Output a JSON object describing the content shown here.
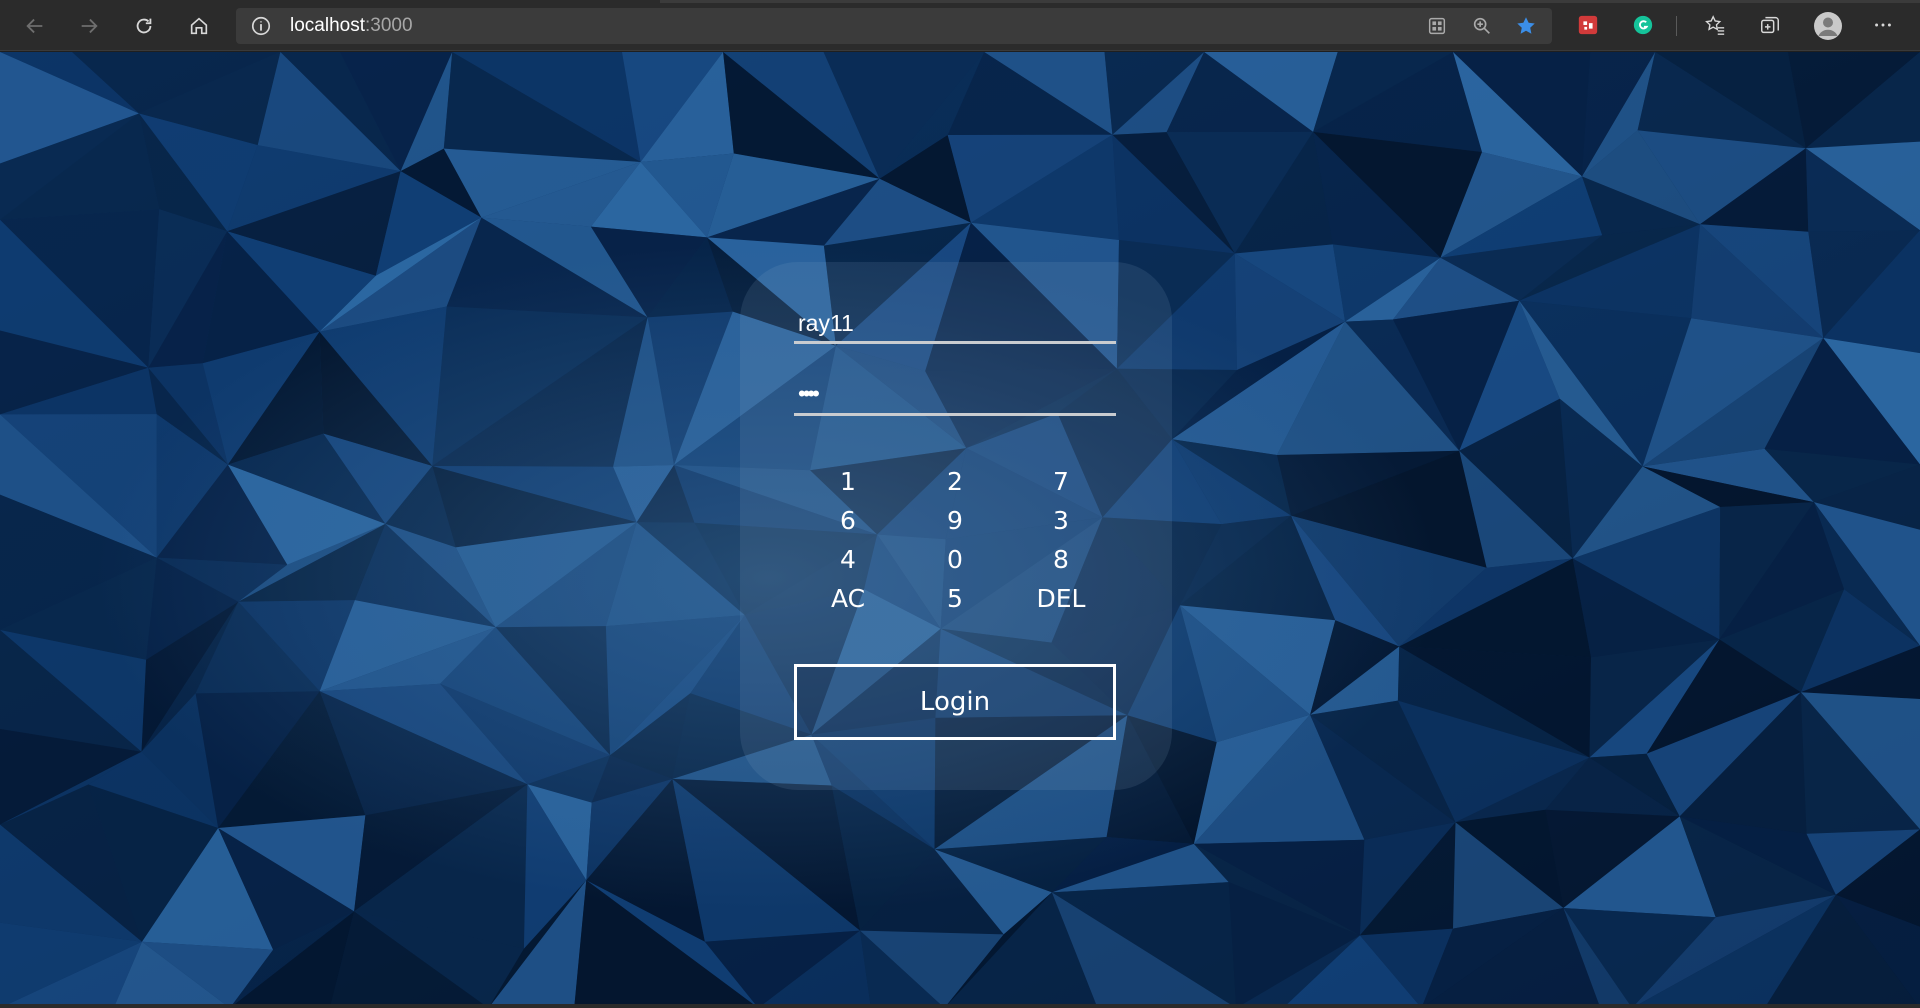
{
  "browser": {
    "url_host": "localhost",
    "url_port": ":3000",
    "icons": {
      "back": "arrow-left-icon",
      "forward": "arrow-right-icon",
      "reload": "reload-icon",
      "home": "home-icon",
      "site_info": "info-icon",
      "apps": "app-grid-icon",
      "zoom": "zoom-icon",
      "favorite": "star-icon",
      "extension_1": "red-extension-icon",
      "extension_grammarly": "grammarly-icon",
      "favorites": "favorites-icon",
      "collections": "collections-icon",
      "profile": "profile-avatar-icon",
      "menu": "more-icon"
    },
    "accent": "#3b8ee8"
  },
  "login": {
    "username_value": "ray11",
    "password_value": "••••",
    "keypad": [
      [
        "1",
        "2",
        "7"
      ],
      [
        "6",
        "9",
        "3"
      ],
      [
        "4",
        "0",
        "8"
      ],
      [
        "AC",
        "5",
        "DEL"
      ]
    ],
    "login_label": "Login"
  },
  "colors": {
    "page_background": "#0b2a52",
    "card_tint": "rgba(150,180,210,0.13)",
    "text": "#ffffff"
  }
}
